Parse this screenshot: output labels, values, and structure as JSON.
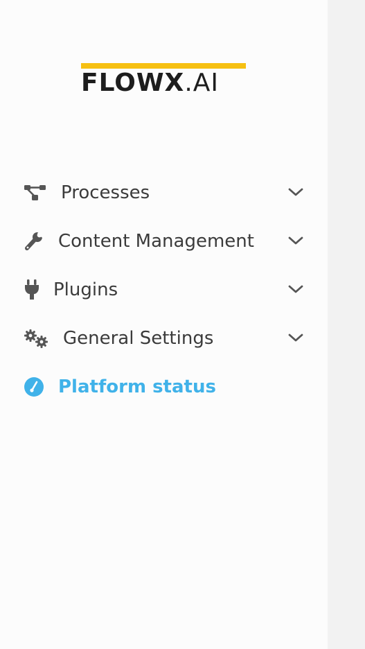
{
  "brand": {
    "logo_text_bold": "FLOWX",
    "logo_text_light": ".AI",
    "accent_color": "#f6c012"
  },
  "sidebar": {
    "items": [
      {
        "label": "Processes",
        "icon": "process-flow-icon",
        "has_submenu": true,
        "active": false
      },
      {
        "label": "Content Management",
        "icon": "wrench-icon",
        "has_submenu": true,
        "active": false
      },
      {
        "label": "Plugins",
        "icon": "plug-icon",
        "has_submenu": true,
        "active": false
      },
      {
        "label": "General Settings",
        "icon": "gears-icon",
        "has_submenu": true,
        "active": false
      },
      {
        "label": "Platform status",
        "icon": "gauge-icon",
        "has_submenu": false,
        "active": true
      }
    ],
    "active_color": "#40b2e9",
    "text_color": "#3b3b3b"
  }
}
